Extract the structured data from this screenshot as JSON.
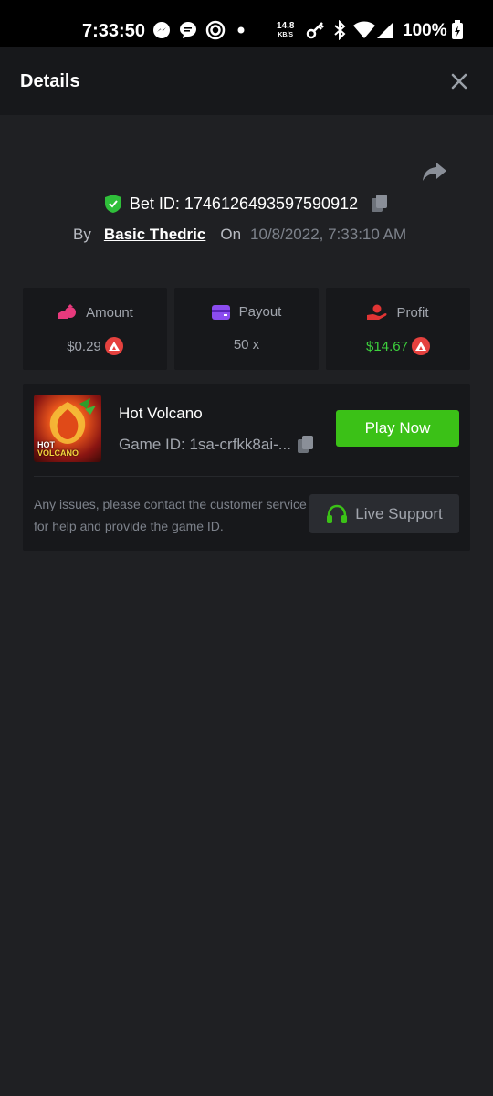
{
  "status_bar": {
    "time": "7:33:50",
    "net_speed_value": "14.8",
    "net_speed_unit": "KB/S",
    "battery": "100%"
  },
  "header": {
    "title": "Details"
  },
  "bet": {
    "id_label": "Bet ID: 1746126493597590912",
    "by_label": "By",
    "username": "Basic Thedric",
    "on_label": "On",
    "date": "10/8/2022, 7:33:10 AM"
  },
  "stats": {
    "amount": {
      "label": "Amount",
      "value": "$0.29"
    },
    "payout": {
      "label": "Payout",
      "value": "50 x"
    },
    "profit": {
      "label": "Profit",
      "value": "$14.67"
    }
  },
  "game": {
    "name": "Hot Volcano",
    "id_label": "Game ID: 1sa-crfkk8ai-...",
    "thumbnail_text_1": "HOT",
    "thumbnail_text_2": "VOLCANO",
    "play_label": "Play Now"
  },
  "support": {
    "text": "Any issues, please contact the customer service for help and provide the game ID.",
    "button_label": "Live Support"
  },
  "colors": {
    "background": "#1f2023",
    "card": "#17181b",
    "accent_green": "#3bc117",
    "profit_green": "#3dd13d",
    "coin_red": "#e5413e"
  }
}
